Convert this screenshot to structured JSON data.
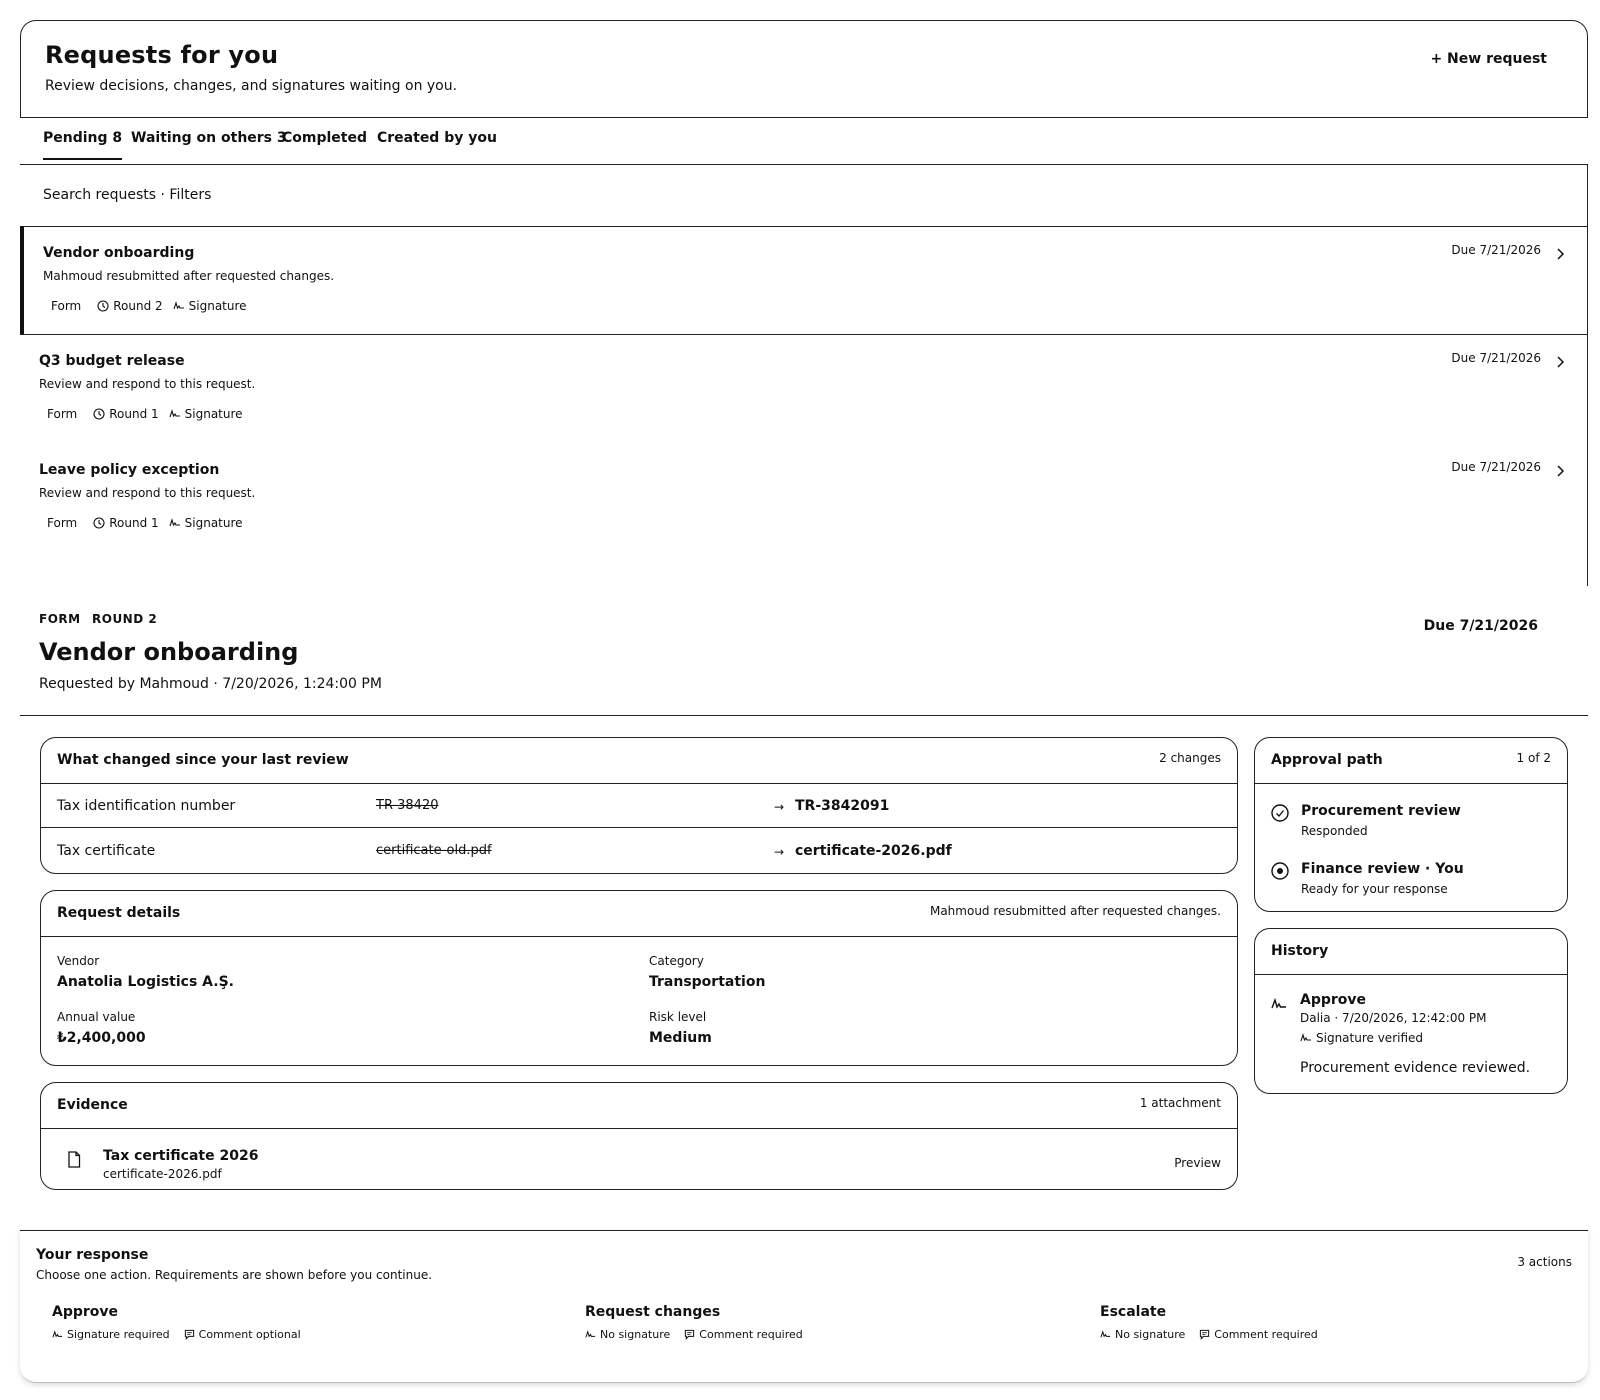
{
  "header": {
    "title": "Requests for you",
    "subtitle": "Review decisions, changes, and signatures waiting on you.",
    "new_request_label": "+ New request"
  },
  "tabs": [
    {
      "label": "Pending 8",
      "active": true
    },
    {
      "label": "Waiting on others 3",
      "active": false
    },
    {
      "label": "Completed",
      "active": false
    },
    {
      "label": "Created by you",
      "active": false
    }
  ],
  "search": {
    "label": "Search requests · Filters"
  },
  "requests": [
    {
      "title": "Vendor onboarding",
      "description": "Mahmoud resubmitted after requested changes.",
      "type": "Form",
      "round": "Round 2",
      "signature": "Signature",
      "due": "Due 7/21/2026",
      "selected": true
    },
    {
      "title": "Q3 budget release",
      "description": "Review and respond to this request.",
      "type": "Form",
      "round": "Round 1",
      "signature": "Signature",
      "due": "Due 7/21/2026",
      "selected": false
    },
    {
      "title": "Leave policy exception",
      "description": "Review and respond to this request.",
      "type": "Form",
      "round": "Round 1",
      "signature": "Signature",
      "due": "Due 7/21/2026",
      "selected": false
    }
  ],
  "detail": {
    "type_tag": "FORM",
    "round_tag": "ROUND 2",
    "title": "Vendor onboarding",
    "requested": "Requested by Mahmoud · 7/20/2026, 1:24:00 PM",
    "due": "Due 7/21/2026"
  },
  "changes": {
    "title": "What changed since your last review",
    "count": "2 changes",
    "arrow": "→",
    "rows": [
      {
        "field": "Tax identification number",
        "old": "TR-38420",
        "new": "TR-3842091"
      },
      {
        "field": "Tax certificate",
        "old": "certificate-old.pdf",
        "new": "certificate-2026.pdf"
      }
    ]
  },
  "request_details": {
    "title": "Request details",
    "note": "Mahmoud resubmitted after requested changes.",
    "fields": [
      {
        "label": "Vendor",
        "value": "Anatolia Logistics A.Ş."
      },
      {
        "label": "Category",
        "value": "Transportation"
      },
      {
        "label": "Annual value",
        "value": "₺2,400,000"
      },
      {
        "label": "Risk level",
        "value": "Medium"
      }
    ]
  },
  "evidence": {
    "title": "Evidence",
    "count": "1 attachment",
    "file_title": "Tax certificate 2026",
    "file_name": "certificate-2026.pdf",
    "preview_label": "Preview"
  },
  "approval": {
    "title": "Approval path",
    "progress": "1 of 2",
    "steps": [
      {
        "title": "Procurement review",
        "status": "Responded",
        "icon": "check-circle-icon"
      },
      {
        "title": "Finance review · You",
        "status": "Ready for your response",
        "icon": "current-step-icon"
      }
    ]
  },
  "history": {
    "title": "History",
    "action": "Approve",
    "who": "Dalia · 7/20/2026, 12:42:00 PM",
    "verified": "Signature verified",
    "comment": "Procurement evidence reviewed."
  },
  "response": {
    "title": "Your response",
    "subtitle": "Choose one action. Requirements are shown before you continue.",
    "count": "3 actions",
    "actions": [
      {
        "title": "Approve",
        "signature": "Signature required",
        "comment": "Comment optional"
      },
      {
        "title": "Request changes",
        "signature": "No signature",
        "comment": "Comment required"
      },
      {
        "title": "Escalate",
        "signature": "No signature",
        "comment": "Comment required"
      }
    ]
  }
}
